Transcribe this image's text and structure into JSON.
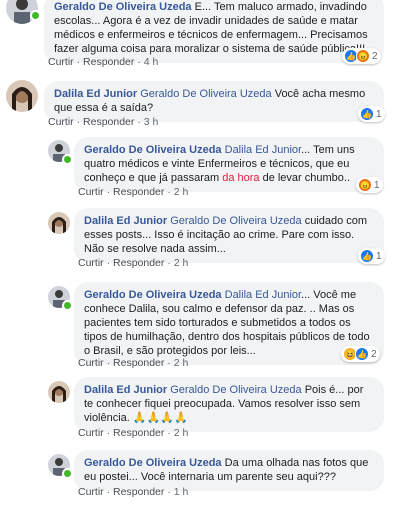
{
  "comments": [
    {
      "author": "Geraldo De Oliveira Uzeda",
      "text": " E... Tem maluco armado, invadindo escolas... Agora é a vez de invadir unidades de saúde e matar médicos e enfermeiros e técnicos de enfermagem... Precisamos fazer alguma coisa para moralizar o sistema de saúde pública!!!",
      "reply": "Curtir",
      "respond": "Responder",
      "time": "4 h",
      "reactions": [
        "like",
        "angry"
      ],
      "count": "2"
    },
    {
      "author": "Dalila Ed Junior",
      "mention": "Geraldo De Oliveira Uzeda",
      "text": " Você acha mesmo que essa é a saída?",
      "reply": "Curtir",
      "respond": "Responder",
      "time": "3 h",
      "reactions": [
        "like"
      ],
      "count": "1"
    },
    {
      "author": "Geraldo De Oliveira Uzeda",
      "mention": "Dalila Ed Junior",
      "text_a": "... Tem uns quatro médicos e vinte Enfermeiros e técnicos, que eu conheço e que já passaram ",
      "highlight": "da hora",
      "text_b": " de levar chumbo..",
      "reply": "Curtir",
      "respond": "Responder",
      "time": "2 h",
      "reactions": [
        "angry"
      ],
      "count": "1"
    },
    {
      "author": "Dalila Ed Junior",
      "mention": "Geraldo De Oliveira Uzeda",
      "text": " cuidado com esses posts... Isso é incitação ao crime. Pare com isso. Não se resolve nada assim...",
      "reply": "Curtir",
      "respond": "Responder",
      "time": "2 h",
      "reactions": [
        "like"
      ],
      "count": "1"
    },
    {
      "author": "Geraldo De Oliveira Uzeda",
      "mention": "Dalila Ed Junior",
      "text": "... Você me conhece Dalila, sou calmo e defensor da paz. .. Mas os pacientes tem sido torturados e submetidos a todos os tipos de humilhação, dentro dos hospitais públicos de todo o Brasil, e são protegidos por leis...",
      "reply": "Curtir",
      "respond": "Responder",
      "time": "2 h",
      "reactions": [
        "haha",
        "like"
      ],
      "count": "2"
    },
    {
      "author": "Dalila Ed Junior",
      "mention": "Geraldo De Oliveira Uzeda",
      "text": " Pois é... por te conhecer fiquei preocupada. Vamos resolver isso sem violência. 🙏🙏🙏🙏",
      "reply": "Curtir",
      "respond": "Responder",
      "time": "2 h"
    },
    {
      "author": "Geraldo De Oliveira Uzeda",
      "text": " Da uma olhada nas fotos que eu postei... Você internaria um parente seu aqui???",
      "reply": "Curtir",
      "respond": "Responder",
      "time": "1 h"
    }
  ],
  "separator": "·"
}
